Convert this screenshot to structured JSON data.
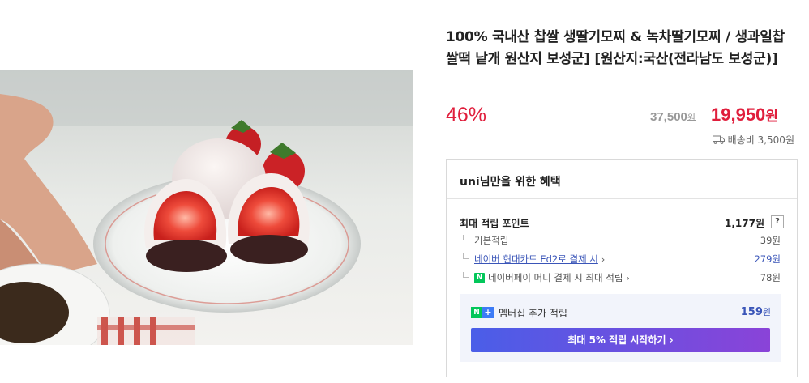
{
  "product": {
    "title": "100% 국내산 찹쌀 생딸기모찌 & 녹차딸기모찌 / 생과일찹쌀떡 낱개 원산지 보성군] [원산지:국산(전라남도 보성군)]",
    "discount_rate": "46%",
    "original_price": "37,500",
    "original_price_unit": "원",
    "sale_price": "19,950",
    "sale_price_unit": "원",
    "shipping_label": "배송비 3,500원",
    "image_icon": "strawberry-mochi-photo"
  },
  "benefits": {
    "header": "uni님만을 위한 혜택",
    "max_points_label": "최대 적립 포인트",
    "max_points_value": "1,177원",
    "help_label": "?",
    "rows": [
      {
        "label": "기본적립",
        "value": "39원"
      },
      {
        "label": "네이버 현대카드 Ed2로 결제 시",
        "value": "279원"
      },
      {
        "label": "네이버페이 머니 결제 시 최대 적립",
        "value": "78원"
      }
    ],
    "npay_icon_text": "N",
    "membership": {
      "label": "멤버십 추가 적립",
      "badge_n": "N",
      "badge_plus": "+",
      "value": "159",
      "value_unit": "원",
      "button_label": "최대 5% 적립 시작하기"
    }
  },
  "colors": {
    "accent_red": "#e01e3c",
    "link_blue": "#3a55b8",
    "naver_green": "#03c75a"
  }
}
